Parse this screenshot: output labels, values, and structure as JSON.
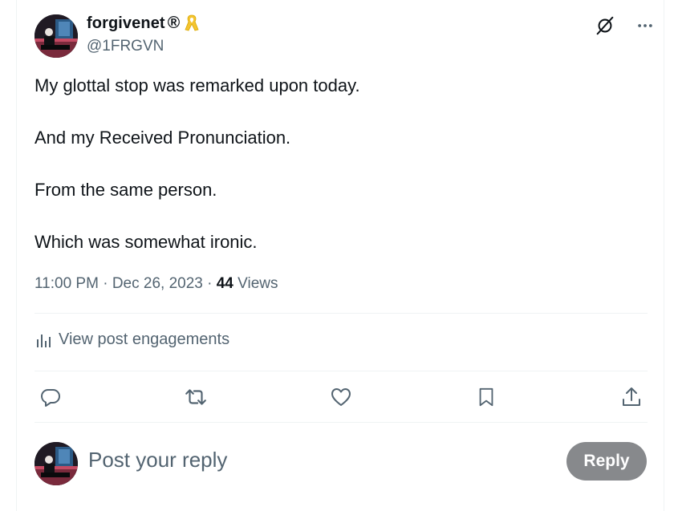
{
  "author": {
    "display_name": "forgivenet",
    "registered_mark": "®",
    "handle": "@1FRGVN",
    "avatar_icon": "avatar-pianist",
    "badge_icon": "yellow-ribbon-icon"
  },
  "tweet": {
    "paragraphs": [
      "My glottal stop was remarked upon today.",
      "And my Received Pronunciation.",
      "From the same person.",
      "Which was somewhat ironic."
    ],
    "time": "11:00 PM",
    "date": "Dec 26, 2023",
    "separator": " · ",
    "views_count": "44",
    "views_label": " Views"
  },
  "engagements": {
    "label": "View post engagements",
    "icon": "bar-chart-icon"
  },
  "actions": [
    "reply-icon",
    "retweet-icon",
    "like-icon",
    "bookmark-icon",
    "share-icon"
  ],
  "reply_box": {
    "placeholder": "Post your reply",
    "button_label": "Reply"
  },
  "colors": {
    "text": "#0f1419",
    "secondary": "#536471",
    "divider": "#eff3f4",
    "reply_button": "#87898c",
    "ribbon": "#f4c430"
  }
}
